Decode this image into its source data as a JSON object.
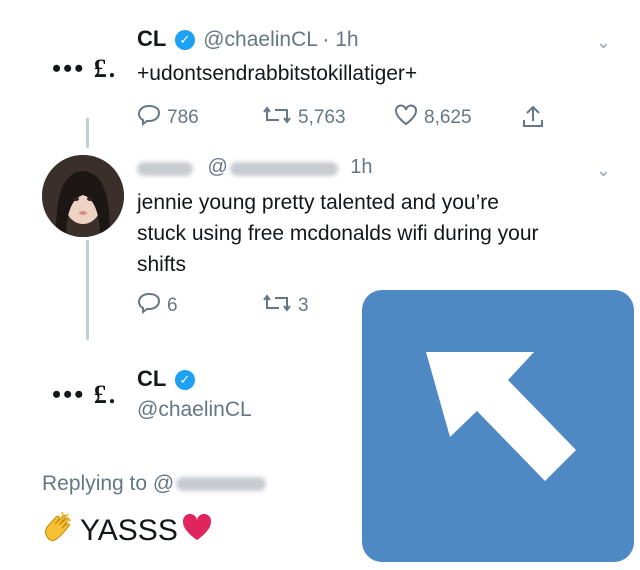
{
  "tweet1": {
    "name": "CL",
    "handle": "@chaelinCL",
    "time": "· 1h",
    "logo": "••• £.",
    "text": "+udontsendrabbitstokillatiger+",
    "actions": {
      "reply": "786",
      "retweet": "5,763",
      "like": "8,625"
    }
  },
  "tweet2": {
    "time": "1h",
    "text_line1": "jennie young pretty talented and you’re",
    "text_line2": "stuck using free mcdonalds wifi during your",
    "text_line3": "shifts",
    "actions": {
      "reply": "6",
      "retweet": "3"
    }
  },
  "tweet3": {
    "name": "CL",
    "handle": "@chaelinCL",
    "replying_to": "Replying to @",
    "reply_text": "YASSS"
  },
  "colors": {
    "accent": "#1da1f2",
    "overlay": "#4e89c4",
    "heart": "#e0245e"
  },
  "icons": [
    "chevron-down-icon",
    "verified-icon",
    "reply-icon",
    "retweet-icon",
    "like-icon",
    "share-icon",
    "clap-emoji-icon",
    "heart-emoji-icon",
    "arrow-up-left-icon"
  ]
}
